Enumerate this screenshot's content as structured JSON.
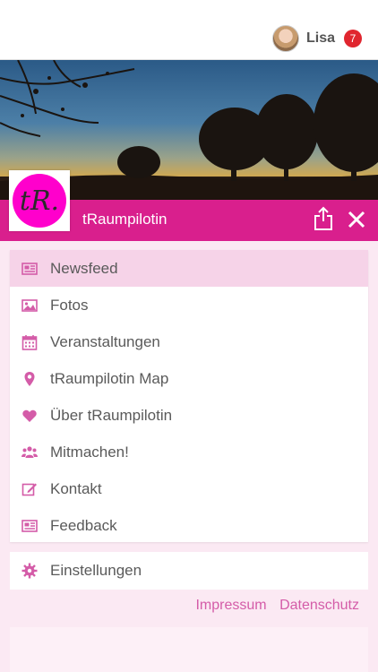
{
  "user": {
    "name": "Lisa",
    "notification_count": "7"
  },
  "page": {
    "title": "tRaumpilotin",
    "logo_text": "tR."
  },
  "menu": [
    {
      "label": "Newsfeed",
      "icon": "newspaper-icon",
      "active": true
    },
    {
      "label": "Fotos",
      "icon": "image-icon"
    },
    {
      "label": "Veranstaltungen",
      "icon": "calendar-icon"
    },
    {
      "label": "tRaumpilotin Map",
      "icon": "map-pin-icon"
    },
    {
      "label": "Über tRaumpilotin",
      "icon": "heart-icon"
    },
    {
      "label": "Mitmachen!",
      "icon": "users-icon"
    },
    {
      "label": "Kontakt",
      "icon": "edit-icon"
    },
    {
      "label": "Feedback",
      "icon": "newspaper-icon"
    }
  ],
  "settings": {
    "label": "Einstellungen",
    "icon": "gear-icon"
  },
  "footer_links": {
    "impressum": "Impressum",
    "datenschutz": "Datenschutz"
  },
  "colors": {
    "accent": "#d91f8d",
    "active_row": "#f6d3e8",
    "icon": "#d45ca8",
    "badge": "#e0262f"
  }
}
